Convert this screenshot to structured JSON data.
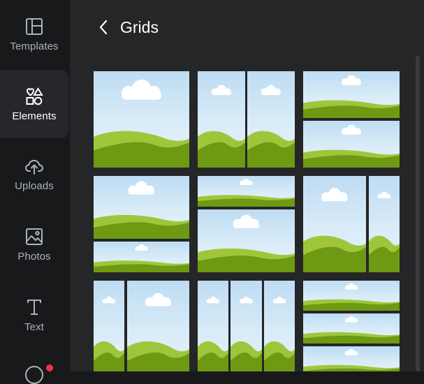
{
  "sidebar": {
    "items": [
      {
        "key": "templates",
        "label": "Templates",
        "icon": "layout-icon",
        "active": false
      },
      {
        "key": "elements",
        "label": "Elements",
        "icon": "shapes-icon",
        "active": true
      },
      {
        "key": "uploads",
        "label": "Uploads",
        "icon": "cloud-upload-icon",
        "active": false
      },
      {
        "key": "photos",
        "label": "Photos",
        "icon": "image-icon",
        "active": false
      },
      {
        "key": "text",
        "label": "Text",
        "icon": "text-t-icon",
        "active": false
      }
    ]
  },
  "header": {
    "title": "Grids",
    "back_icon": "chevron-left-icon"
  },
  "colors": {
    "rail_bg": "#18191b",
    "panel_bg": "#252627",
    "active_item_bg": "#26272b",
    "sky": "#cfe6f6",
    "grass_light": "#9fc63b",
    "grass_dark": "#6e9a13",
    "notification": "#e8344a"
  },
  "grids": [
    {
      "name": "grid-single"
    },
    {
      "name": "grid-two-columns"
    },
    {
      "name": "grid-two-rows"
    },
    {
      "name": "grid-large-top-small-bottom"
    },
    {
      "name": "grid-small-top-large-bottom"
    },
    {
      "name": "grid-large-left-small-right"
    },
    {
      "name": "grid-narrow-left-wide-right"
    },
    {
      "name": "grid-three-columns"
    },
    {
      "name": "grid-three-rows"
    }
  ]
}
